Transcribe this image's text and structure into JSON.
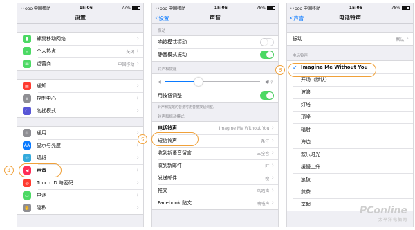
{
  "colors": {
    "accent": "#0a7aff",
    "toggle_on": "#4cd964",
    "callout": "#f0a13a"
  },
  "status": {
    "carrier": "••ooo 中国移动",
    "wifi": "wifi-icon",
    "time": "15:06"
  },
  "screen1": {
    "title": "设置",
    "battery": "77%",
    "groups": [
      [
        {
          "icon": "cellular-icon",
          "color": "#4cd964",
          "label": "蜂窝移动网络",
          "value": ""
        },
        {
          "icon": "hotspot-icon",
          "color": "#4cd964",
          "label": "个人热点",
          "value": "关闭"
        },
        {
          "icon": "carrier-phone-icon",
          "color": "#4cd964",
          "label": "运营商",
          "value": "中国移动"
        }
      ],
      [
        {
          "icon": "notifications-icon",
          "color": "#ff3b30",
          "label": "通知",
          "value": ""
        },
        {
          "icon": "control-center-icon",
          "color": "#8e8e93",
          "label": "控制中心",
          "value": ""
        },
        {
          "icon": "moon-icon",
          "color": "#5856d6",
          "label": "勿扰模式",
          "value": ""
        }
      ],
      [
        {
          "icon": "gear-icon",
          "color": "#8e8e93",
          "label": "通用",
          "value": ""
        },
        {
          "icon": "aa-icon",
          "color": "#0a7aff",
          "label": "显示与亮度",
          "value": ""
        },
        {
          "icon": "flower-icon",
          "color": "#34aadc",
          "label": "墙纸",
          "value": ""
        },
        {
          "icon": "speaker-icon",
          "color": "#ff2d55",
          "label": "声音",
          "value": ""
        },
        {
          "icon": "fingerprint-icon",
          "color": "#ff3b30",
          "label": "Touch ID 与密码",
          "value": ""
        },
        {
          "icon": "battery-icon",
          "color": "#4cd964",
          "label": "电池",
          "value": ""
        },
        {
          "icon": "hand-icon",
          "color": "#8e8e93",
          "label": "隐私",
          "value": ""
        }
      ]
    ]
  },
  "screen2": {
    "title": "声音",
    "back": "设置",
    "battery": "78%",
    "vibrate_header": "振动",
    "vibrate_ring": "响铃模式振动",
    "vibrate_silent": "静音模式振动",
    "ringer_header": "铃声和提醒",
    "volume_level": 0.35,
    "change_with_buttons": "用按钮调整",
    "note": "铃声和提醒的音量可用音量按钮调整。",
    "patterns_header": "铃声和振动模式",
    "patterns": [
      {
        "label": "电话铃声",
        "value": "Imagine Me Without You"
      },
      {
        "label": "短信铃声",
        "value": "备注"
      },
      {
        "label": "收到新语音留言",
        "value": "三全音"
      },
      {
        "label": "收到新邮件",
        "value": "叮"
      },
      {
        "label": "发送邮件",
        "value": "嗖"
      },
      {
        "label": "推文",
        "value": "鸟鸣声"
      },
      {
        "label": "Facebook 贴文",
        "value": "嘀嗒声"
      }
    ]
  },
  "screen3": {
    "title": "电话铃声",
    "back": "声音",
    "battery": "78%",
    "vibration_label": "振动",
    "vibration_value": "默认",
    "ringtones_header": "电话铃声",
    "ringtones": [
      "Imagine Me Without You",
      "开场（默认）",
      "波浪",
      "灯塔",
      "顶峰",
      "辐射",
      "海边",
      "欢乐时光",
      "缓慢上升",
      "急板",
      "煎茶",
      "举起"
    ]
  },
  "callouts": [
    "4",
    "5",
    "6"
  ],
  "watermark": {
    "brand": "PConline",
    "sub": "太平洋电脑网"
  }
}
